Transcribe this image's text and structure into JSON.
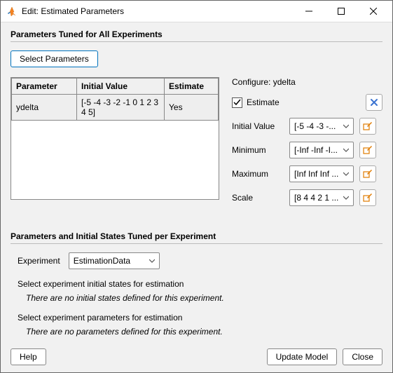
{
  "window_title": "Edit: Estimated Parameters",
  "section1_title": "Parameters Tuned for All Experiments",
  "select_params_btn": "Select Parameters",
  "table": {
    "headers": {
      "param": "Parameter",
      "initval": "Initial Value",
      "estimate": "Estimate"
    },
    "rows": [
      {
        "param": "ydelta",
        "initval": "[-5 -4 -3 -2 -1 0 1 2 3 4 5]",
        "estimate": "Yes"
      }
    ]
  },
  "config": {
    "title_prefix": "Configure:",
    "target": "ydelta",
    "estimate_label": "Estimate",
    "fields": {
      "initial": {
        "label": "Initial Value",
        "value": "[-5 -4 -3 -..."
      },
      "minimum": {
        "label": "Minimum",
        "value": "[-Inf -Inf -I..."
      },
      "maximum": {
        "label": "Maximum",
        "value": "[Inf Inf Inf ..."
      },
      "scale": {
        "label": "Scale",
        "value": "[8 4 4 2 1 ..."
      }
    }
  },
  "section2_title": "Parameters and Initial States Tuned per Experiment",
  "experiment_label": "Experiment",
  "experiment_value": "EstimationData",
  "sub_initstates": "Select experiment initial states for estimation",
  "msg_no_initstates": "There are no initial states defined for this experiment.",
  "sub_params": "Select experiment parameters for estimation",
  "msg_no_params": "There are no parameters defined for this experiment.",
  "footer": {
    "help": "Help",
    "update": "Update Model",
    "close": "Close"
  }
}
